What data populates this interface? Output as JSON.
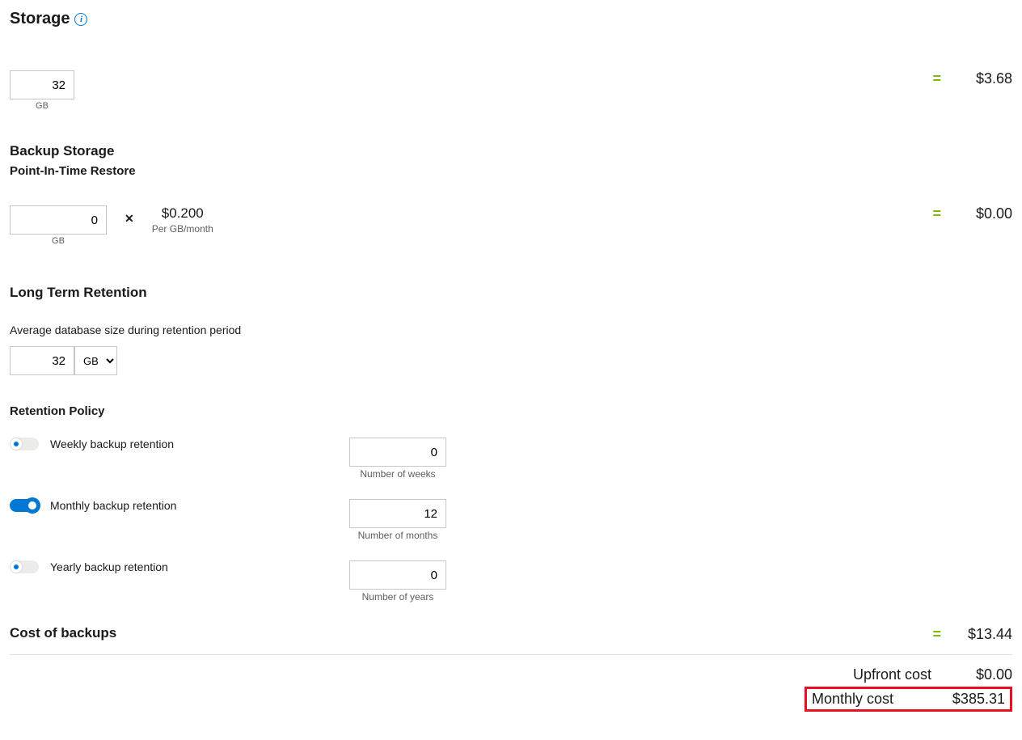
{
  "storage": {
    "heading": "Storage",
    "value": "32",
    "unit": "GB",
    "cost": "$3.68",
    "equals": "="
  },
  "backup": {
    "heading": "Backup Storage",
    "subheading": "Point-In-Time Restore",
    "value": "0",
    "unit": "GB",
    "mult": "✕",
    "rate": "$0.200",
    "rate_label": "Per GB/month",
    "cost": "$0.00",
    "equals": "="
  },
  "ltr": {
    "heading": "Long Term Retention",
    "avg_label": "Average database size during retention period",
    "avg_value": "32",
    "avg_unit": "GB",
    "policy_heading": "Retention Policy",
    "weekly": {
      "label": "Weekly backup retention",
      "on": false,
      "value": "0",
      "unit_label": "Number of weeks"
    },
    "monthly": {
      "label": "Monthly backup retention",
      "on": true,
      "value": "12",
      "unit_label": "Number of months"
    },
    "yearly": {
      "label": "Yearly backup retention",
      "on": false,
      "value": "0",
      "unit_label": "Number of years"
    }
  },
  "cost_of_backups": {
    "heading": "Cost of backups",
    "equals": "=",
    "cost": "$13.44"
  },
  "summary": {
    "upfront_label": "Upfront cost",
    "upfront_value": "$0.00",
    "monthly_label": "Monthly cost",
    "monthly_value": "$385.31"
  }
}
